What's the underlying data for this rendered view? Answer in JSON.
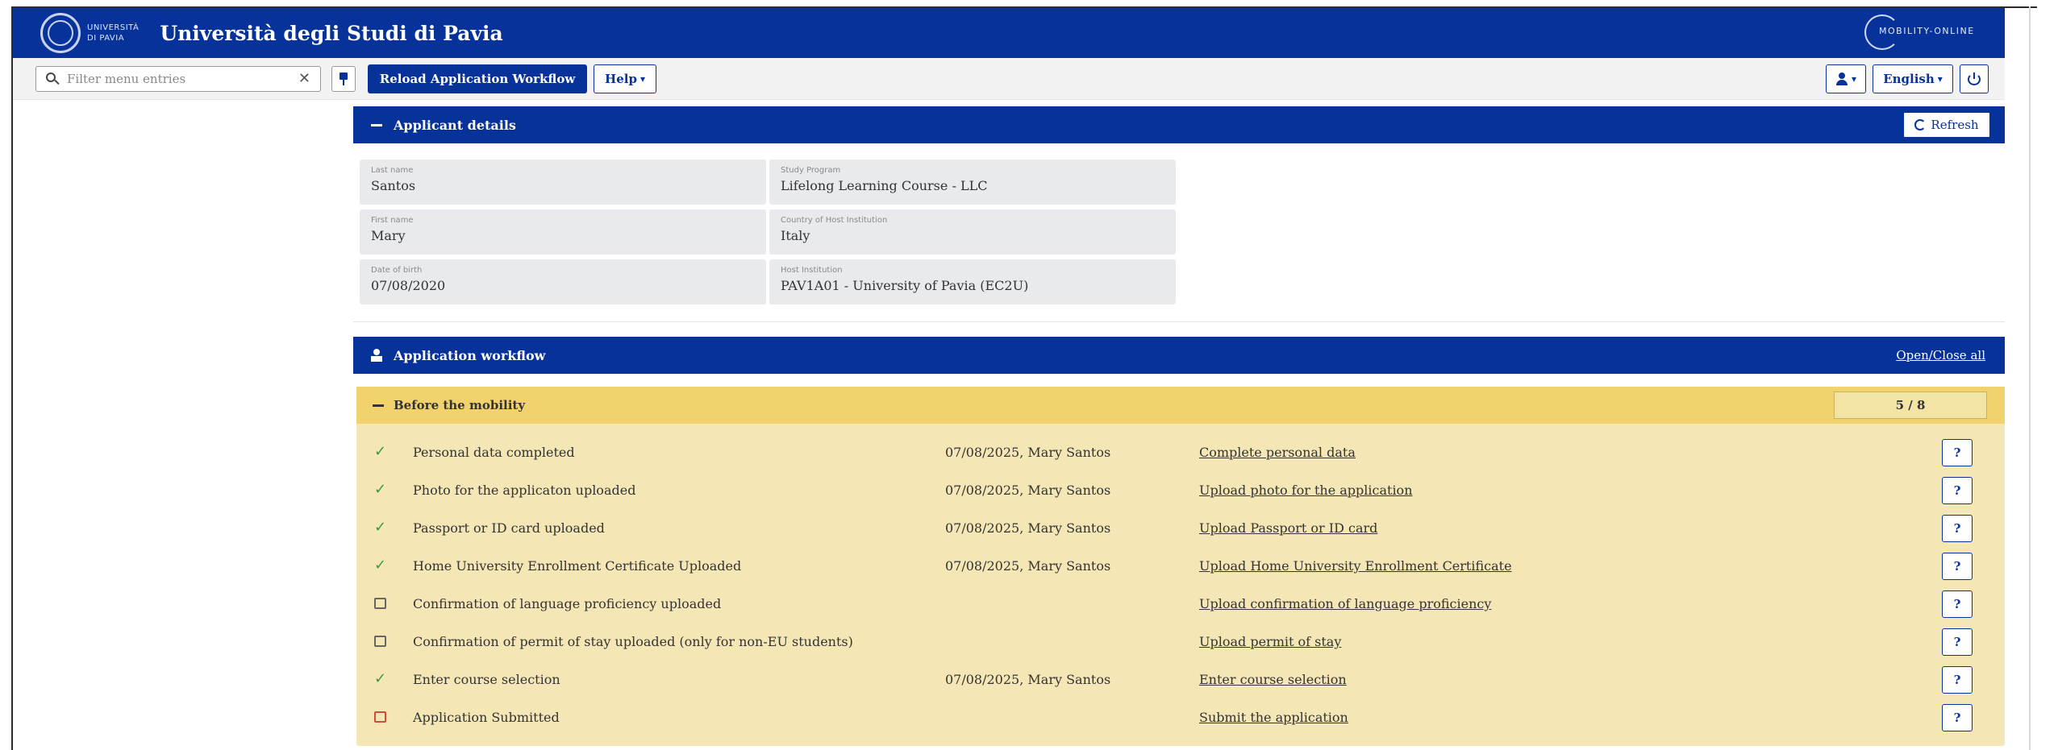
{
  "header": {
    "university_logo_text": [
      "UNIVERSITÀ",
      "DI PAVIA"
    ],
    "app_title": "Università degli Studi di Pavia",
    "brand_logo_text": "MOBILITY-ONLINE"
  },
  "toolbar": {
    "filter_placeholder": "Filter menu entries",
    "clear_symbol": "✕",
    "reload_label": "Reload Application Workflow",
    "help_label": "Help",
    "language_label": "English"
  },
  "applicant": {
    "title": "Applicant details",
    "refresh_label": "Refresh",
    "fields": {
      "last_name": {
        "label": "Last name",
        "value": "Santos"
      },
      "first_name": {
        "label": "First name",
        "value": "Mary"
      },
      "dob": {
        "label": "Date of birth",
        "value": "07/08/2020"
      },
      "study_program": {
        "label": "Study Program",
        "value": "Lifelong Learning Course - LLC"
      },
      "host_country": {
        "label": "Country of Host Institution",
        "value": "Italy"
      },
      "host_institution": {
        "label": "Host Institution",
        "value": "PAV1A01 - University of Pavia (EC2U)"
      }
    }
  },
  "workflow": {
    "title": "Application workflow",
    "open_close_label": "Open/Close all",
    "stage": {
      "title": "Before the mobility",
      "count": "5 / 8",
      "steps": [
        {
          "status": "done",
          "label": "Personal data completed",
          "date": "07/08/2025, Mary Santos",
          "link": "Complete personal data"
        },
        {
          "status": "done",
          "label": "Photo for the applicaton uploaded",
          "date": "07/08/2025, Mary Santos",
          "link": "Upload photo for the application"
        },
        {
          "status": "done",
          "label": "Passport or ID card uploaded",
          "date": "07/08/2025, Mary Santos",
          "link": "Upload Passport or ID card"
        },
        {
          "status": "done",
          "label": "Home University Enrollment Certificate Uploaded",
          "date": "07/08/2025, Mary Santos",
          "link": "Upload Home University Enrollment Certificate"
        },
        {
          "status": "open",
          "label": "Confirmation of language proficiency uploaded",
          "date": "",
          "link": "Upload confirmation of language proficiency"
        },
        {
          "status": "open",
          "label": "Confirmation of permit of stay uploaded (only for non-EU students)",
          "date": "",
          "link": "Upload permit of stay"
        },
        {
          "status": "done",
          "label": "Enter course selection",
          "date": "07/08/2025, Mary Santos",
          "link": "Enter course selection"
        },
        {
          "status": "required",
          "label": "Application Submitted",
          "date": "",
          "link": "Submit the application"
        }
      ],
      "help_symbol": "?"
    }
  },
  "colors": {
    "brand_blue": "#06329a",
    "stage_header": "#f1d26d",
    "stage_body": "#f5e6b6",
    "done_green": "#3a9b3a",
    "required_red": "#d24a3a"
  },
  "icons": {
    "done": "check-icon",
    "open": "checkbox-icon",
    "required": "checkbox-red-icon"
  }
}
